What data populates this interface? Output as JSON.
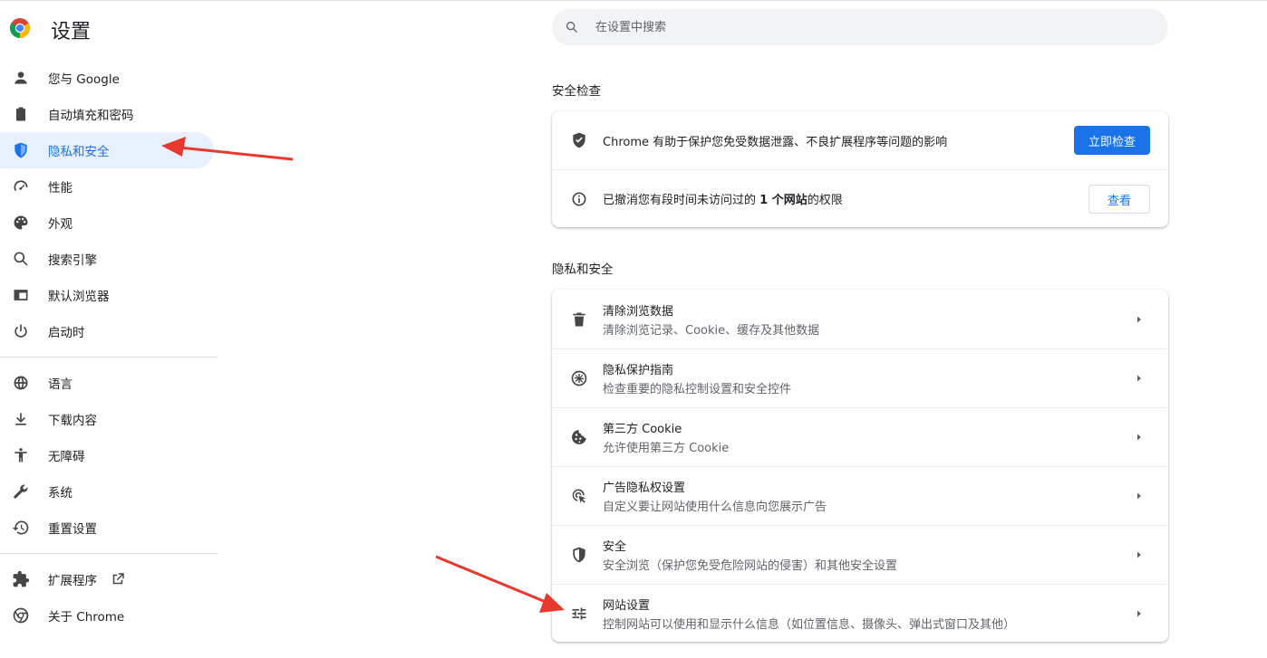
{
  "header": {
    "title": "设置"
  },
  "search": {
    "placeholder": "在设置中搜索"
  },
  "sidebar": {
    "items": [
      {
        "label": "您与 Google",
        "icon": "person-icon"
      },
      {
        "label": "自动填充和密码",
        "icon": "clipboard-icon"
      },
      {
        "label": "隐私和安全",
        "icon": "shield-icon",
        "active": true
      },
      {
        "label": "性能",
        "icon": "speedometer-icon"
      },
      {
        "label": "外观",
        "icon": "palette-icon"
      },
      {
        "label": "搜索引擎",
        "icon": "search-icon"
      },
      {
        "label": "默认浏览器",
        "icon": "browser-window-icon"
      },
      {
        "label": "启动时",
        "icon": "power-icon"
      },
      {
        "label": "语言",
        "icon": "globe-icon"
      },
      {
        "label": "下载内容",
        "icon": "download-icon"
      },
      {
        "label": "无障碍",
        "icon": "accessibility-icon"
      },
      {
        "label": "系统",
        "icon": "wrench-icon"
      },
      {
        "label": "重置设置",
        "icon": "reset-icon"
      },
      {
        "label": "扩展程序",
        "icon": "puzzle-icon"
      },
      {
        "label": "关于 Chrome",
        "icon": "chrome-icon"
      }
    ]
  },
  "safety_check": {
    "title": "安全检查",
    "row1_text": "Chrome 有助于保护您免受数据泄露、不良扩展程序等问题的影响",
    "row1_button": "立即检查",
    "row2_prefix": "已撤消您有段时间未访问过的 ",
    "row2_bold": "1 个网站",
    "row2_suffix": "的权限",
    "row2_button": "查看"
  },
  "privacy": {
    "title": "隐私和安全",
    "rows": [
      {
        "title": "清除浏览数据",
        "subtitle": "清除浏览记录、Cookie、缓存及其他数据",
        "icon": "trash-icon"
      },
      {
        "title": "隐私保护指南",
        "subtitle": "检查重要的隐私控制设置和安全控件",
        "icon": "compass-icon"
      },
      {
        "title": "第三方 Cookie",
        "subtitle": "允许使用第三方 Cookie",
        "icon": "cookie-icon"
      },
      {
        "title": "广告隐私权设置",
        "subtitle": "自定义要让网站使用什么信息向您展示广告",
        "icon": "ad-target-icon"
      },
      {
        "title": "安全",
        "subtitle": "安全浏览（保护您免受危险网站的侵害）和其他安全设置",
        "icon": "security-shield-icon"
      },
      {
        "title": "网站设置",
        "subtitle": "控制网站可以使用和显示什么信息（如位置信息、摄像头、弹出式窗口及其他）",
        "icon": "tune-icon"
      }
    ]
  },
  "colors": {
    "accent": "#1a73e8",
    "annotation": "#e8392f",
    "active_bg": "#e8f0fe"
  }
}
